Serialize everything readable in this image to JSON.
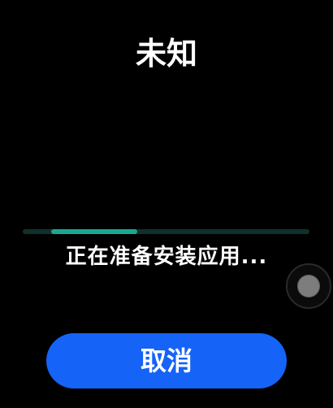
{
  "app": {
    "title": "未知"
  },
  "install": {
    "status_text": "正在准备安装应用...",
    "progress_fraction": 0.3,
    "progress_offset_fraction": 0.1
  },
  "actions": {
    "cancel_label": "取消"
  },
  "colors": {
    "background": "#000000",
    "accent_button": "#1563f7",
    "progress_fill": "#1aa792",
    "progress_track": "#11302c",
    "text": "#ffffff"
  }
}
